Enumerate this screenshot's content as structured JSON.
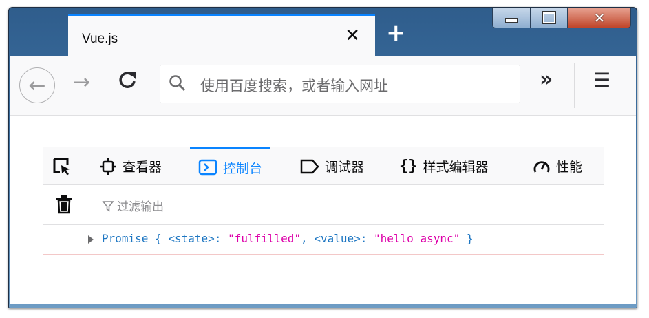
{
  "browser": {
    "tab_title": "Vue.js",
    "tab_close": "✕",
    "new_tab": "+",
    "url_placeholder": "使用百度搜索，或者输入网址",
    "overflow_label": "»",
    "menu_label": "☰",
    "back_label": "←",
    "forward_label": "→",
    "reload_label": "C"
  },
  "devtools": {
    "tabs": [
      {
        "label": "查看器",
        "icon": "inspector-icon"
      },
      {
        "label": "控制台",
        "icon": "console-icon",
        "active": true
      },
      {
        "label": "调试器",
        "icon": "debugger-icon"
      },
      {
        "label": "样式编辑器",
        "icon": "style-editor-icon"
      },
      {
        "label": "性能",
        "icon": "performance-icon"
      }
    ],
    "filter_placeholder": "过滤输出",
    "console": {
      "object_name": "Promise",
      "open_brace": "{",
      "state_key": "<state>:",
      "state_value": "\"fulfilled\"",
      "comma": ",",
      "value_key": "<value>:",
      "value_value": "\"hello async\"",
      "close_brace": "}"
    }
  },
  "colors": {
    "accent": "#0a84ff",
    "console_string": "#dd00a9",
    "console_key": "#1d76c2"
  }
}
